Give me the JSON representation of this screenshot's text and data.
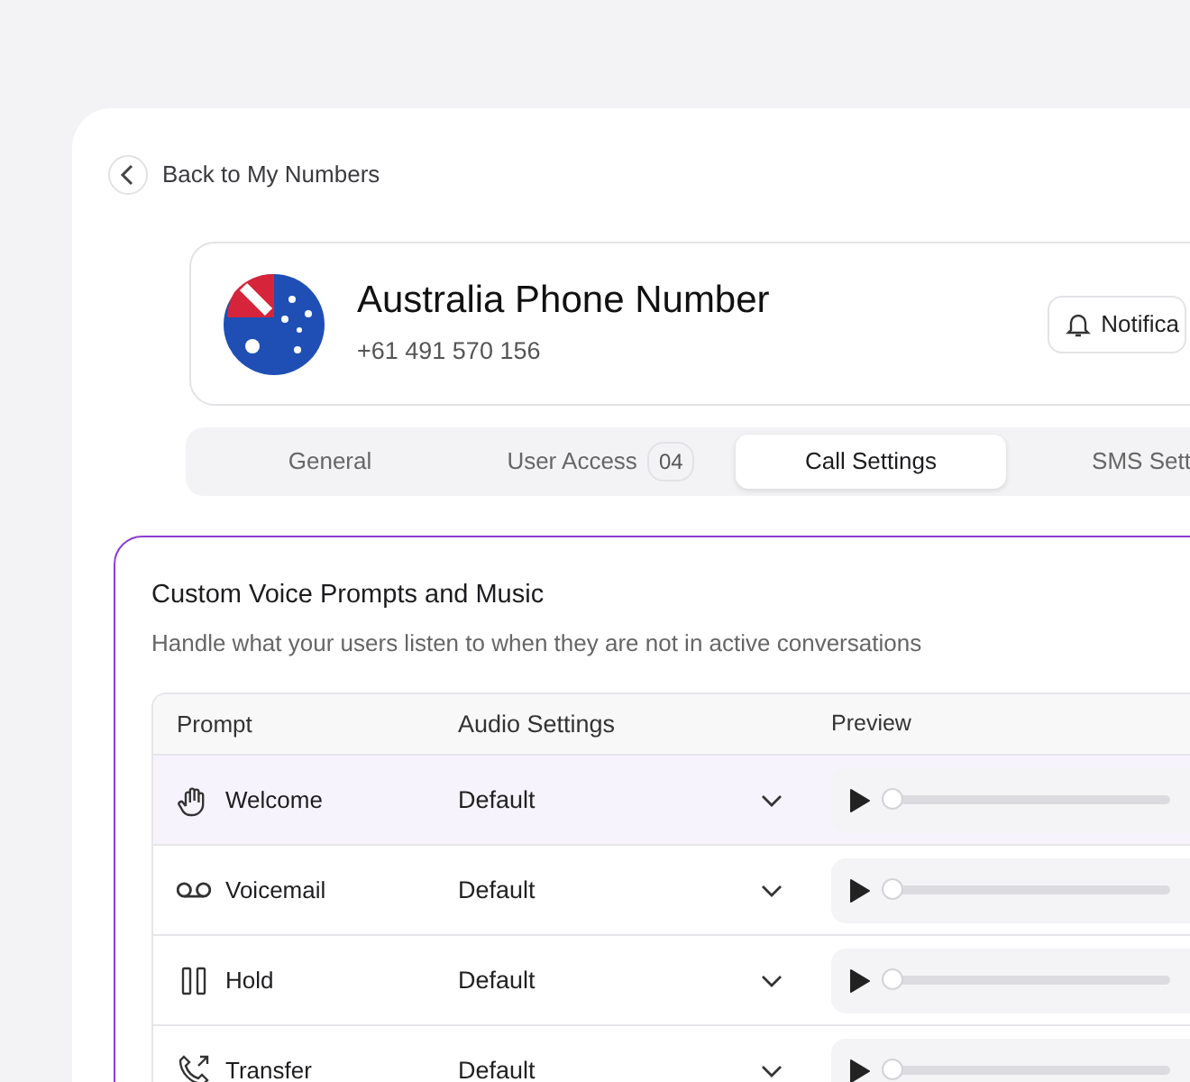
{
  "back_link": {
    "label": "Back to My Numbers"
  },
  "number_card": {
    "title": "Australia Phone Number",
    "phone": "+61 491 570 156",
    "button": "Notifica"
  },
  "tabs": [
    {
      "label": "General",
      "selected": false
    },
    {
      "label": "User Access",
      "count": "04",
      "selected": false
    },
    {
      "label": "Call Settings",
      "selected": true
    },
    {
      "label": "SMS Sett",
      "selected": false
    }
  ],
  "section": {
    "title": "Custom Voice Prompts and Music",
    "subtitle": "Handle what your users listen to when they are not in active conversations"
  },
  "table": {
    "columns": [
      "Prompt",
      "Audio Settings",
      "Preview"
    ],
    "rows": [
      {
        "kind": "welcome",
        "prompt": "Welcome",
        "audio": "Default",
        "level": 0,
        "selected": true
      },
      {
        "kind": "voicemail",
        "prompt": "Voicemail",
        "audio": "Default",
        "level": 0,
        "selected": false
      },
      {
        "kind": "hold",
        "prompt": "Hold",
        "audio": "Default",
        "level": 0,
        "selected": false
      },
      {
        "kind": "transfer",
        "prompt": "Transfer",
        "audio": "Default",
        "level": 0,
        "selected": false
      }
    ]
  }
}
